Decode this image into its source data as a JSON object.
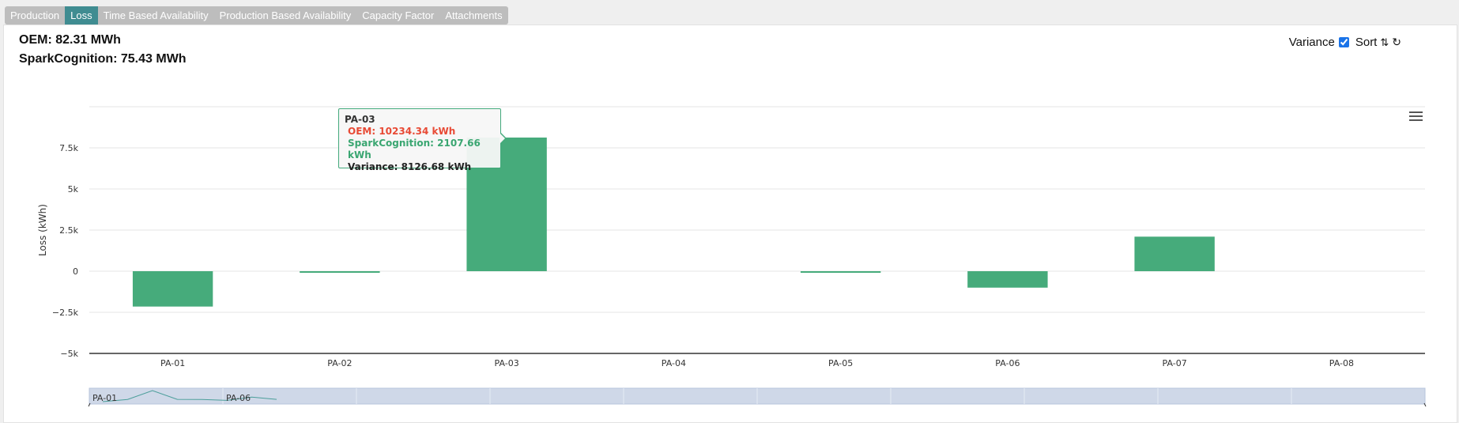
{
  "tabs": [
    {
      "label": "Production",
      "active": false
    },
    {
      "label": "Loss",
      "active": true
    },
    {
      "label": "Time Based Availability",
      "active": false
    },
    {
      "label": "Production Based Availability",
      "active": false
    },
    {
      "label": "Capacity Factor",
      "active": false
    },
    {
      "label": "Attachments",
      "active": false
    }
  ],
  "summary": {
    "oem": "OEM: 82.31 MWh",
    "spark": "SparkCognition: 75.43 MWh"
  },
  "controls": {
    "variance_label": "Variance",
    "variance_checked": true,
    "sort_label": "Sort",
    "sort_icon": "sort-icon",
    "refresh_icon": "refresh-icon"
  },
  "tooltip": {
    "title": "PA-03",
    "oem": "OEM: 10234.34 kWh",
    "spark": "SparkCognition: 2107.66 kWh",
    "variance": "Variance: 8126.68 kWh"
  },
  "colors": {
    "bar": "#46ab7b",
    "oem": "#e84a35",
    "spark": "#3aa671",
    "navigator": "#cfd8e8",
    "navigator_line": "#4b9e9a"
  },
  "chart_data": {
    "type": "bar",
    "categories": [
      "PA-01",
      "PA-02",
      "PA-03",
      "PA-04",
      "PA-05",
      "PA-06",
      "PA-07",
      "PA-08"
    ],
    "series": [
      {
        "values": [
          -2150,
          -60,
          8126.68,
          0,
          -60,
          -1000,
          2100,
          0
        ]
      }
    ],
    "ylabel": "Loss (kWh)",
    "ylim": [
      -5000,
      10000
    ],
    "yticks": [
      -5000,
      -2500,
      0,
      2500,
      5000,
      7500
    ],
    "ytick_labels": [
      "−5k",
      "−2.5k",
      "0",
      "2.5k",
      "5k",
      "7.5k"
    ],
    "grid": true,
    "legend": "none",
    "navigator": {
      "labels": [
        "PA-01",
        "PA-06"
      ],
      "values": [
        -2150,
        -60,
        8126.68,
        0,
        -60,
        -1000,
        2100,
        0
      ]
    }
  }
}
